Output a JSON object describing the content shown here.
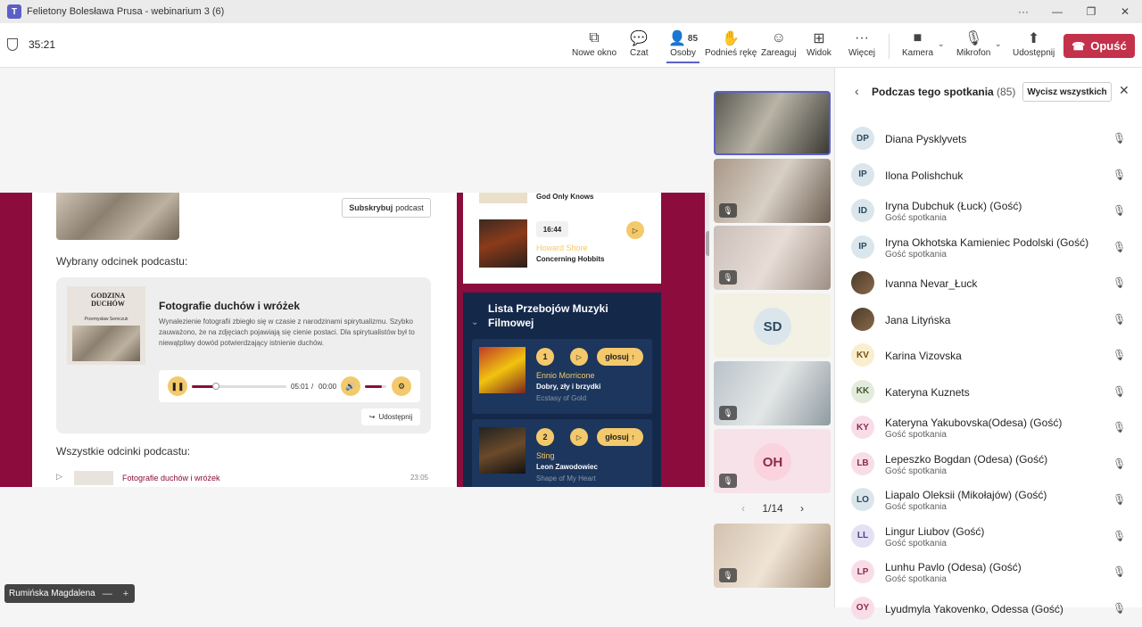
{
  "window": {
    "title": "Felietony Bolesława Prusa - webinarium 3 (6)"
  },
  "toolbar": {
    "timer": "35:21",
    "buttons": {
      "new_window": "Nowe okno",
      "chat": "Czat",
      "people": "Osoby",
      "people_count": "85",
      "raise_hand": "Podnieś rękę",
      "react": "Zareaguj",
      "view": "Widok",
      "more": "Więcej",
      "camera": "Kamera",
      "mic": "Mikrofon",
      "share": "Udostępnij",
      "leave": "Opuść"
    }
  },
  "shared": {
    "subscribe_bold": "Subskrybuj",
    "subscribe_rest": "podcast",
    "selected_label": "Wybrany odcinek podcastu:",
    "episode": {
      "cover_title": "GODZINA DUCHÓW",
      "cover_author": "Przemysław Semczuk",
      "title": "Fotografie duchów i wróżek",
      "description": "Wynalezienie fotografii zbiegło się w czasie z narodzinami spirytualizmu. Szybko zauważono, że na zdjęciach pojawiają się cienie postaci. Dla spirytualistów był to niewątpliwy dowód potwierdzający istnienie duchów.",
      "time_current": "05:01",
      "time_sep": "/",
      "time_total": "00:00",
      "progress": 0.25,
      "volume": 0.8,
      "share_label": "Udostępnij"
    },
    "all_label": "Wszystkie odcinki podcastu:",
    "list_item": {
      "title": "Fotografie duchów i wróżek",
      "duration": "23:05"
    },
    "now_playing": {
      "prev_title": "God Only Knows",
      "time": "16:44",
      "artist": "Howard Shore",
      "title": "Concerning Hobbits"
    },
    "chart_list": {
      "title": "Lista Przebojów Muzyki Filmowej",
      "vote_label": "głosuj ↑",
      "items": [
        {
          "rank": "1",
          "artist": "Ennio Morricone",
          "film": "Dobry, zły i brzydki",
          "song": "Ecstasy of Gold"
        },
        {
          "rank": "2",
          "artist": "Sting",
          "film": "Leon Zawodowiec",
          "song": "Shape of My Heart"
        }
      ]
    }
  },
  "video": {
    "tiles": [
      {
        "initials": ""
      },
      {
        "initials": ""
      },
      {
        "initials": ""
      },
      {
        "initials": "SD"
      },
      {
        "initials": ""
      },
      {
        "initials": "OH"
      }
    ],
    "pager": "1/14",
    "self_tile": {
      "initials": ""
    }
  },
  "people_panel": {
    "title": "Podczas tego spotkania",
    "count": "(85)",
    "mute_all": "Wycisz wszystkich",
    "participants": [
      {
        "initials": "DP",
        "name": "Diana Pysklyvets",
        "sub": ""
      },
      {
        "initials": "IP",
        "name": "Ilona Polishchuk",
        "sub": ""
      },
      {
        "initials": "ID",
        "name": "Iryna Dubchuk (Łuck) (Gość)",
        "sub": "Gość spotkania"
      },
      {
        "initials": "IP",
        "name": "Iryna Okhotska Kamieniec Podolski (Gość)",
        "sub": "Gość spotkania"
      },
      {
        "initials": "",
        "name": "Ivanna Nevar_Łuck",
        "sub": ""
      },
      {
        "initials": "",
        "name": "Jana Lityńska",
        "sub": ""
      },
      {
        "initials": "KV",
        "name": "Karina Vizovska",
        "sub": ""
      },
      {
        "initials": "KK",
        "name": "Kateryna Kuznets",
        "sub": ""
      },
      {
        "initials": "KY",
        "name": "Kateryna Yakubovska(Odesa) (Gość)",
        "sub": "Gość spotkania"
      },
      {
        "initials": "LB",
        "name": "Lepeszko Bogdan (Odesa) (Gość)",
        "sub": "Gość spotkania"
      },
      {
        "initials": "LO",
        "name": "Liapalo Oleksii (Mikołajów) (Gość)",
        "sub": "Gość spotkania"
      },
      {
        "initials": "LL",
        "name": "Lingur Liubov (Gość)",
        "sub": "Gość spotkania"
      },
      {
        "initials": "LP",
        "name": "Lunhu Pavlo (Odesa) (Gość)",
        "sub": "Gość spotkania"
      },
      {
        "initials": "OY",
        "name": "Lyudmyla Yakovenko, Odessa (Gość)",
        "sub": ""
      }
    ]
  },
  "presenter_label": {
    "name": "Rumińska Magdalena",
    "minus": "—",
    "plus": "+"
  },
  "colors": {
    "accent": "#5b5fc7",
    "leave": "#c4314b",
    "site_bg": "#8b0c3d",
    "gold": "#f4c96b",
    "navy": "#14284a"
  }
}
